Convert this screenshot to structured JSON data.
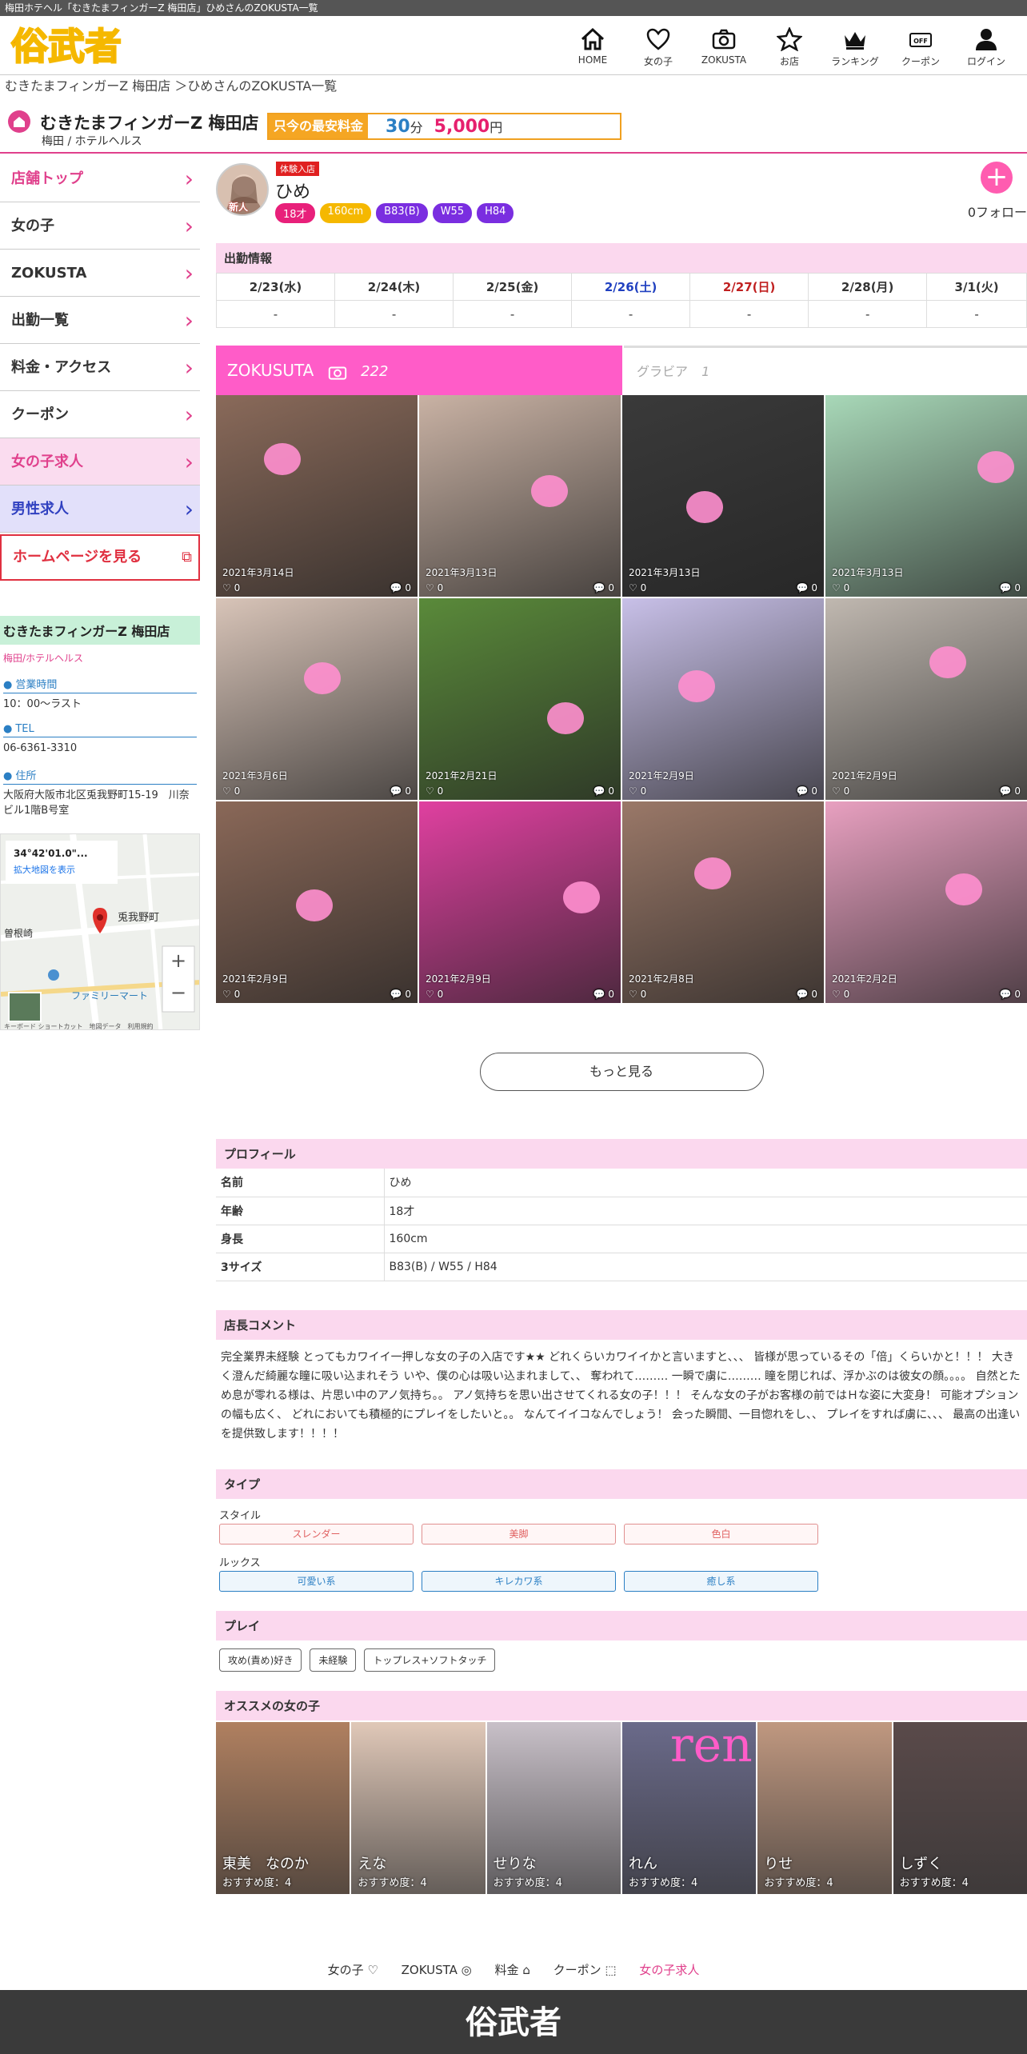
{
  "page_title": "梅田ホテヘル「むきたまフィンガーZ 梅田店」ひめさんのZOKUSTA一覧",
  "site": {
    "logo_text": "俗武者"
  },
  "nav": [
    {
      "label": "HOME",
      "icon": "home-icon"
    },
    {
      "label": "女の子",
      "icon": "heart-icon"
    },
    {
      "label": "ZOKUSTA",
      "icon": "camera-icon"
    },
    {
      "label": "お店",
      "icon": "star-icon"
    },
    {
      "label": "ランキング",
      "icon": "crown-icon"
    },
    {
      "label": "クーポン",
      "icon": "coupon-icon"
    },
    {
      "label": "ログイン",
      "icon": "user-icon"
    }
  ],
  "breadcrumb": "むきたまフィンガーZ 梅田店 ＞ひめさんのZOKUSTA一覧",
  "shop": {
    "name": "むきたまフィンガーZ 梅田店",
    "area": "梅田 / ホテルヘルス",
    "price_label": "只今の最安料金",
    "price_minutes": "30",
    "price_min_unit": "分",
    "price_amount": "5,000",
    "price_yen_unit": "円"
  },
  "sidebar": [
    {
      "label": "店舗トップ"
    },
    {
      "label": "女の子"
    },
    {
      "label": "ZOKUSTA"
    },
    {
      "label": "出勤一覧"
    },
    {
      "label": "料金・アクセス"
    },
    {
      "label": "クーポン"
    },
    {
      "label": "女の子求人"
    },
    {
      "label": "男性求人"
    },
    {
      "label": "ホームページを見る"
    }
  ],
  "shop_info": {
    "title": "むきたまフィンガーZ 梅田店",
    "sub": "梅田/ホテルヘルス",
    "hours_label": "営業時間",
    "hours": "10：00～ラスト",
    "tel_label": "TEL",
    "tel": "06-6361-3310",
    "address_label": "住所",
    "address": "大阪府大阪市北区兎我野町15-19　川奈ビル1階B号室"
  },
  "map": {
    "coords": "34°42'01.0\"...",
    "expand": "拡大地図を表示",
    "place": "兎我野町",
    "place2": "曽根崎",
    "store": "ファミリーマート",
    "footer": "キーボード ショートカット　地図データ　利用規約"
  },
  "girl": {
    "badge": "体験入店",
    "name": "ひめ",
    "new_label": "新人",
    "tags": [
      {
        "text": "18才",
        "color": "#e8207a"
      },
      {
        "text": "160cm",
        "color": "#f5b800"
      },
      {
        "text": "B83(B)",
        "color": "#7a2ee0"
      },
      {
        "text": "W55",
        "color": "#7a2ee0"
      },
      {
        "text": "H84",
        "color": "#7a2ee0"
      }
    ],
    "follow": "0フォロー"
  },
  "schedule": {
    "title": "出勤情報",
    "days": [
      {
        "date": "2/23(水)",
        "val": "-"
      },
      {
        "date": "2/24(木)",
        "val": "-"
      },
      {
        "date": "2/25(金)",
        "val": "-"
      },
      {
        "date": "2/26(土)",
        "val": "-"
      },
      {
        "date": "2/27(日)",
        "val": "-"
      },
      {
        "date": "2/28(月)",
        "val": "-"
      },
      {
        "date": "3/1(火)",
        "val": "-"
      }
    ]
  },
  "zokusta": {
    "tab_a": "ZOKUSUTA",
    "count_a": "222",
    "tab_b": "グラビア",
    "count_b": "1",
    "photos": [
      {
        "date": "2021年3月14日",
        "likes": "0",
        "comments": "0",
        "bg": "#8a6a5a"
      },
      {
        "date": "2021年3月13日",
        "likes": "0",
        "comments": "0",
        "bg": "#c9b2a4"
      },
      {
        "date": "2021年3月13日",
        "likes": "0",
        "comments": "0",
        "bg": "#3a3a3a"
      },
      {
        "date": "2021年3月13日",
        "likes": "0",
        "comments": "0",
        "bg": "#a8d8b8"
      },
      {
        "date": "2021年3月6日",
        "likes": "0",
        "comments": "0",
        "bg": "#d8c4b8"
      },
      {
        "date": "2021年2月21日",
        "likes": "0",
        "comments": "0",
        "bg": "#5a8a3a"
      },
      {
        "date": "2021年2月9日",
        "likes": "0",
        "comments": "0",
        "bg": "#c8c0e8"
      },
      {
        "date": "2021年2月9日",
        "likes": "0",
        "comments": "0",
        "bg": "#c0b8b0"
      },
      {
        "date": "2021年2月9日",
        "likes": "0",
        "comments": "0",
        "bg": "#8a6858"
      },
      {
        "date": "2021年2月9日",
        "likes": "0",
        "comments": "0",
        "bg": "#e040a0"
      },
      {
        "date": "2021年2月8日",
        "likes": "0",
        "comments": "0",
        "bg": "#9a7868"
      },
      {
        "date": "2021年2月2日",
        "likes": "0",
        "comments": "0",
        "bg": "#e8a0c0"
      }
    ],
    "more": "もっと見る"
  },
  "profile": {
    "title": "プロフィール",
    "rows": [
      {
        "k": "名前",
        "v": "ひめ"
      },
      {
        "k": "年齢",
        "v": "18才"
      },
      {
        "k": "身長",
        "v": "160cm"
      },
      {
        "k": "3サイズ",
        "v": "B83(B) / W55 / H84"
      }
    ]
  },
  "comment": {
    "title": "店長コメント",
    "text": "完全業界未経験 とってもカワイイ一押しな女の子の入店です★★ どれくらいカワイイかと言いますと、、、 皆様が思っているその「倍」くらいかと！！！ 大きく澄んだ綺麗な瞳に吸い込まれそう いや、僕の心は吸い込まれまして、、 奪われて……… 一瞬で虜に……… 瞳を閉じれば、浮かぶのは彼女の顔。。。。 自然とため息が零れる様は、片思い中のアノ気持ち。。 アノ気持ちを思い出させてくれる女の子！！！ そんな女の子がお客様の前ではＨな姿に大変身！ 可能オプションの幅も広く、 どれにおいても積極的にプレイをしたいと。。 なんてイイコなんでしょう！ 会った瞬間、一目惚れをし、、 プレイをすれば虜に、、、 最高の出逢いを提供致します！！！！"
  },
  "types": {
    "title": "タイプ",
    "style_label": "スタイル",
    "styles": [
      "スレンダー",
      "美脚",
      "色白"
    ],
    "looks_label": "ルックス",
    "looks": [
      "可愛い系",
      "キレカワ系",
      "癒し系"
    ]
  },
  "play": {
    "title": "プレイ",
    "items": [
      "攻め(責め)好き",
      "未経験",
      "トップレス+ソフトタッチ"
    ]
  },
  "recommend": {
    "title": "オススメの女の子",
    "girls": [
      {
        "name": "東美　なのか",
        "score": "おすすめ度：4",
        "bg": "#b08060"
      },
      {
        "name": "えな",
        "score": "おすすめ度：4",
        "bg": "#e0c8b8"
      },
      {
        "name": "せりな",
        "score": "おすすめ度：4",
        "bg": "#c8c0c8"
      },
      {
        "name": "れん",
        "score": "おすすめ度：4",
        "bg": "#6a6a8a"
      },
      {
        "name": "りせ",
        "score": "おすすめ度：4",
        "bg": "#c09880"
      },
      {
        "name": "しずく",
        "score": "おすすめ度：4",
        "bg": "#5a4a4a"
      }
    ],
    "overlay_text": "ren"
  },
  "footer_links": [
    {
      "label": "女の子 ♡"
    },
    {
      "label": "ZOKUSTA ◎"
    },
    {
      "label": "料金 ⌂"
    },
    {
      "label": "クーポン ⬚"
    },
    {
      "label": "女の子求人"
    }
  ],
  "footer_logo": "俗武者"
}
